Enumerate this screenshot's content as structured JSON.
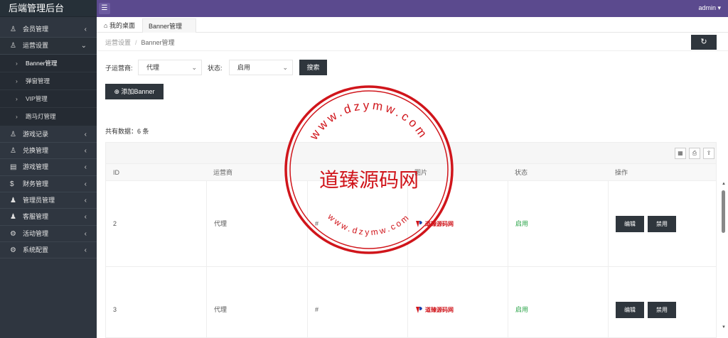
{
  "app": {
    "title": "后端管理后台"
  },
  "topbar": {
    "menu_icon": "hamburger-icon",
    "user": "admin"
  },
  "sidebar": {
    "items": [
      {
        "icon": "user-icon",
        "label": "会员管理",
        "arrow": "‹"
      },
      {
        "icon": "user-icon",
        "label": "运营设置",
        "arrow": "⌄",
        "open": true
      },
      {
        "icon": "user-icon",
        "label": "游戏记录",
        "arrow": "‹"
      },
      {
        "icon": "user-icon",
        "label": "兑换管理",
        "arrow": "‹"
      },
      {
        "icon": "calendar-icon",
        "label": "游戏管理",
        "arrow": "‹"
      },
      {
        "icon": "dollar-icon",
        "label": "财务管理",
        "arrow": "‹"
      },
      {
        "icon": "users-icon",
        "label": "管理员管理",
        "arrow": "‹"
      },
      {
        "icon": "users-icon",
        "label": "客服管理",
        "arrow": "‹"
      },
      {
        "icon": "gear-icon",
        "label": "活动管理",
        "arrow": "‹"
      },
      {
        "icon": "gear-icon",
        "label": "系统配置",
        "arrow": "‹"
      }
    ],
    "subitems": [
      {
        "label": "Banner管理",
        "active": true
      },
      {
        "label": "弹窗管理"
      },
      {
        "label": "VIP管理"
      },
      {
        "label": "跑马灯管理"
      }
    ]
  },
  "tabs": {
    "home": "我的桌面",
    "active": "Banner管理",
    "close": "×"
  },
  "breadcrumb": {
    "parent": "运营设置",
    "separator": "/",
    "current": "Banner管理"
  },
  "filters": {
    "operator_label": "子运营商:",
    "operator_value": "代理",
    "status_label": "状态:",
    "status_value": "启用",
    "search_button": "搜索",
    "add_button": "添加Banner"
  },
  "count_text": "共有数据：6 条",
  "table": {
    "columns": [
      "ID",
      "运营商",
      "",
      "图片",
      "状态",
      "操作"
    ],
    "rows": [
      {
        "id": "2",
        "operator": "代理",
        "link": "#",
        "image": "道臻源码网",
        "status": "启用",
        "edit": "编辑",
        "disable": "禁用"
      },
      {
        "id": "3",
        "operator": "代理",
        "link": "#",
        "image": "道臻源码网",
        "status": "启用",
        "edit": "编辑",
        "disable": "禁用"
      }
    ]
  },
  "watermark": {
    "top_arc": "www.dzymw.com",
    "center": "道臻源码网",
    "bottom_arc": "www.dzymw.com"
  },
  "colors": {
    "topbar": "#5b4a8e",
    "sidebar": "#2f3640",
    "button": "#2f363d",
    "status_on": "#25a244",
    "seal_red": "#d0151b"
  }
}
